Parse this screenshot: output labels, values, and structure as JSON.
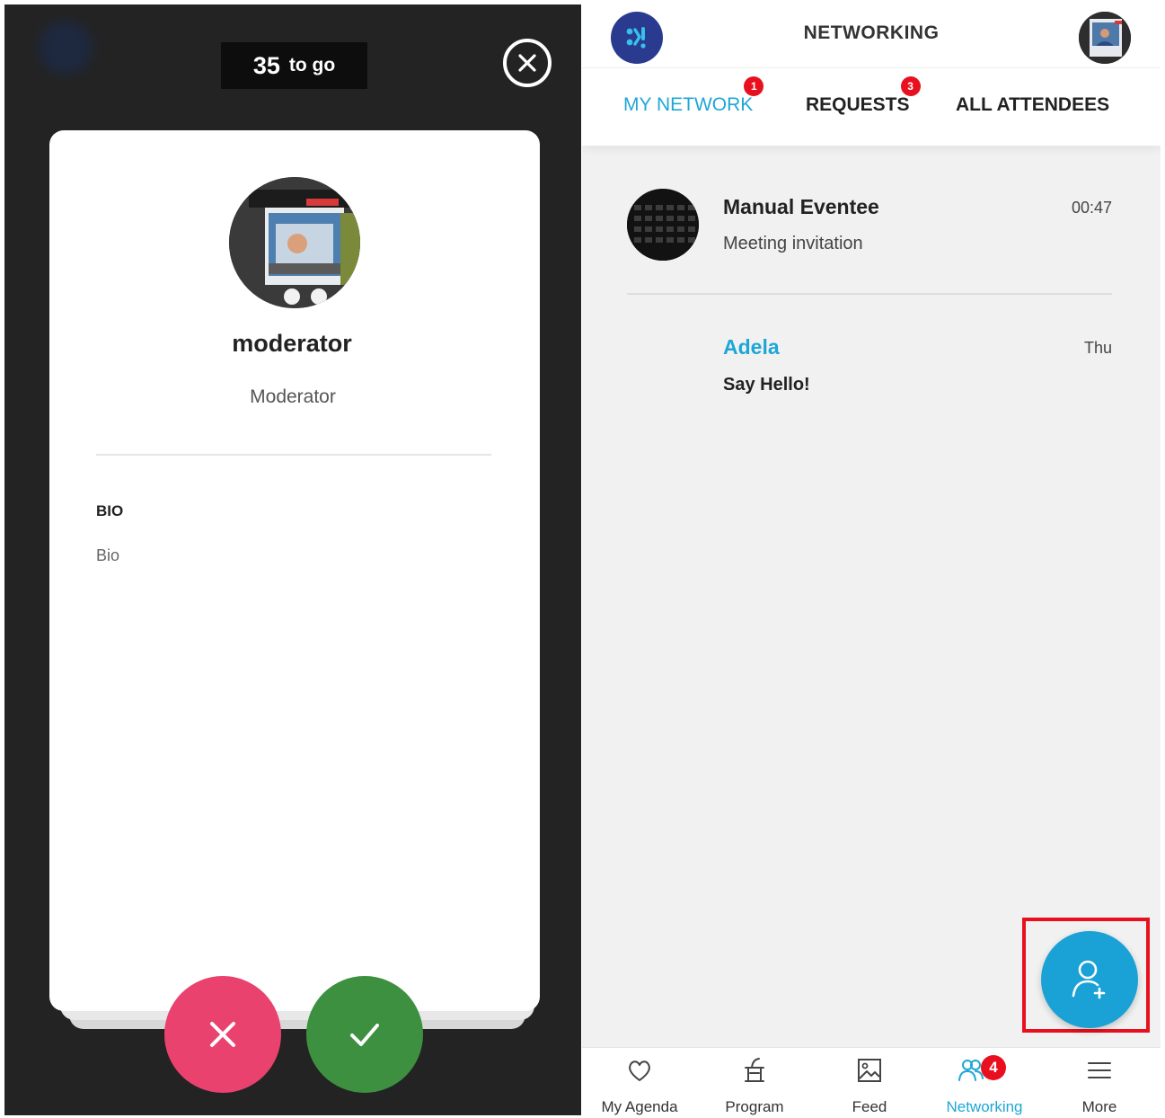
{
  "left": {
    "counter": {
      "number": "35",
      "label": "to go"
    },
    "profile": {
      "name": "moderator",
      "role": "Moderator",
      "bio_heading": "BIO",
      "bio_text": "Bio"
    }
  },
  "right": {
    "title": "NETWORKING",
    "tabs": [
      {
        "label": "MY NETWORK",
        "badge": "1",
        "active": true
      },
      {
        "label": "REQUESTS",
        "badge": "3",
        "active": false
      },
      {
        "label": "ALL ATTENDEES",
        "badge": "",
        "active": false
      }
    ],
    "conversations": [
      {
        "name": "Manual Eventee",
        "subtitle": "Meeting invitation",
        "time": "00:47"
      },
      {
        "name": "Adela",
        "subtitle": "Say Hello!",
        "time": "Thu"
      }
    ],
    "bottom_nav": [
      {
        "label": "My Agenda",
        "icon": "heart-icon"
      },
      {
        "label": "Program",
        "icon": "program-icon"
      },
      {
        "label": "Feed",
        "icon": "image-icon"
      },
      {
        "label": "Networking",
        "icon": "people-icon",
        "badge": "4",
        "active": true
      },
      {
        "label": "More",
        "icon": "menu-icon"
      }
    ]
  },
  "colors": {
    "accent": "#1ea7d6",
    "reject": "#e9426e",
    "accept": "#3d9040",
    "badge": "#e8101e",
    "logo": "#2a3b8f"
  }
}
